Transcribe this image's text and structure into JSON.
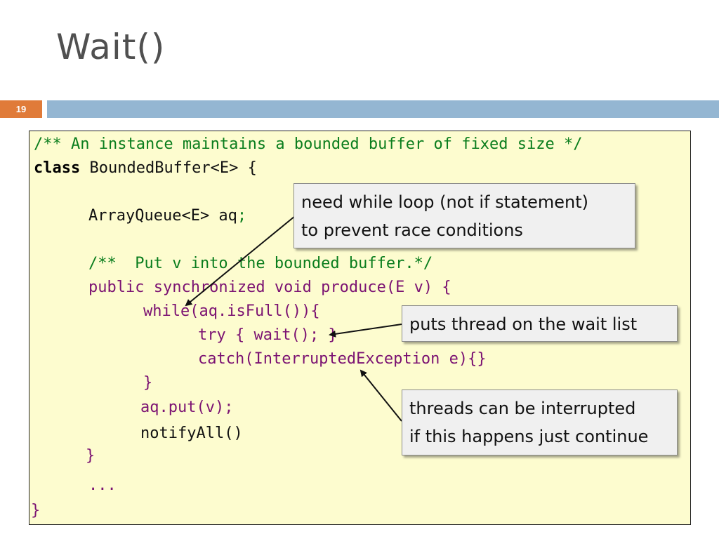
{
  "slide": {
    "title": "Wait()",
    "number": "19"
  },
  "code": {
    "line1": "/** An instance maintains a bounded buffer of fixed size */",
    "line2_kw": "class",
    "line2_rest": " BoundedBuffer<E> {",
    "line3_a": "ArrayQueue<E> aq",
    "line3_b": ";",
    "line4": "/**  Put v into the bounded buffer.*/",
    "line5": "public synchronized void produce(E v) {",
    "line6": "while(aq.isFull()){",
    "line7": "try { wait(); }",
    "line8": "catch(InterruptedException e){}",
    "line9": "}",
    "line10": "aq.put(v);",
    "line11": "notifyAll()",
    "line12": "}",
    "line13": "...",
    "line14": "}"
  },
  "callouts": {
    "while_loop": [
      "need while loop (not if statement)",
      "to prevent race conditions"
    ],
    "wait_list": [
      "puts thread on the wait list"
    ],
    "interrupted": [
      "threads can be interrupted",
      "if this happens just continue"
    ]
  }
}
